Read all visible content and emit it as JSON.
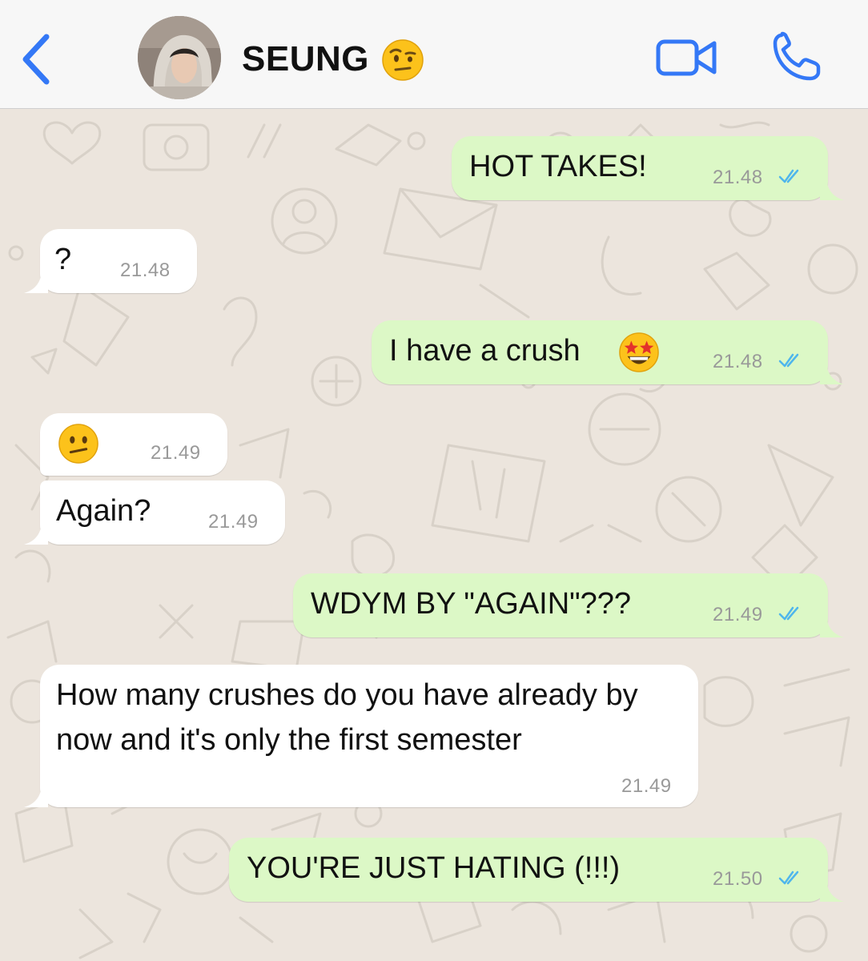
{
  "header": {
    "contact_name": "SEUNG",
    "name_emoji": "face-with-raised-eyebrow",
    "icons": {
      "back": "chevron-left-icon",
      "video": "video-camera-icon",
      "call": "phone-icon"
    },
    "accent_color": "#3478f6"
  },
  "colors": {
    "outgoing_bubble": "#dcf8c6",
    "incoming_bubble": "#ffffff",
    "chat_background": "#ece5dd",
    "read_ticks": "#4fb6ec",
    "timestamp": "#999999"
  },
  "messages": [
    {
      "direction": "out",
      "text": "HOT TAKES!",
      "time": "21.48",
      "status": "read"
    },
    {
      "direction": "in",
      "text": "?",
      "time": "21.48"
    },
    {
      "direction": "out",
      "text": "I have a crush",
      "emoji": "star-struck",
      "time": "21.48",
      "status": "read"
    },
    {
      "direction": "in",
      "text": "",
      "emoji": "confused-face",
      "time": "21.49"
    },
    {
      "direction": "in",
      "text": "Again?",
      "time": "21.49"
    },
    {
      "direction": "out",
      "text": "WDYM BY \"AGAIN\"???",
      "time": "21.49",
      "status": "read"
    },
    {
      "direction": "in",
      "text": "How many crushes do you have already by now and it's only the first semester",
      "time": "21.49"
    },
    {
      "direction": "out",
      "text": "YOU'RE JUST HATING (!!!)",
      "time": "21.50",
      "status": "read"
    }
  ]
}
